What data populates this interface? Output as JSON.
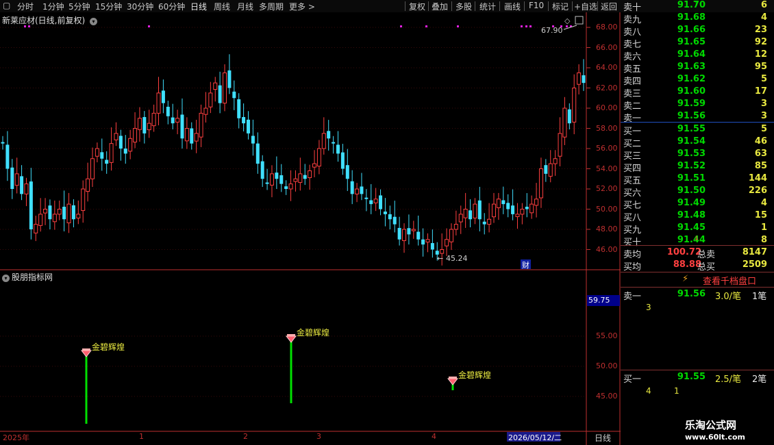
{
  "toolbar": {
    "periods": [
      "分时",
      "1分钟",
      "5分钟",
      "15分钟",
      "30分钟",
      "60分钟",
      "日线",
      "周线",
      "月线",
      "多周期",
      "更多"
    ],
    "actions": [
      "复权",
      "叠加",
      "多股",
      "统计",
      "画线",
      "F10",
      "标记",
      "+自选",
      "返回"
    ]
  },
  "chart": {
    "title": "新莱应材(日线,前复权)",
    "high_label": "67.90",
    "low_label": "45.24",
    "cai_badge": "财",
    "price_ticks": [
      "68.00",
      "66.00",
      "64.00",
      "62.00",
      "60.00",
      "58.00",
      "56.00",
      "54.00",
      "52.00",
      "50.00",
      "48.00",
      "46.00"
    ],
    "indicator_title": "股朋指标网",
    "indicator_ticks": [
      "55.00",
      "50.00",
      "45.00"
    ],
    "indicator_current": "59.75",
    "signal_label": "金碧辉煌",
    "date_axis": [
      "2025年",
      "1",
      "2",
      "3",
      "4"
    ],
    "cursor_date": "2026/05/12/二",
    "period_label": "日线"
  },
  "orderbook": {
    "asks": [
      {
        "label": "卖十",
        "price": "91.70",
        "vol": "6"
      },
      {
        "label": "卖九",
        "price": "91.68",
        "vol": "4"
      },
      {
        "label": "卖八",
        "price": "91.66",
        "vol": "23"
      },
      {
        "label": "卖七",
        "price": "91.65",
        "vol": "92"
      },
      {
        "label": "卖六",
        "price": "91.64",
        "vol": "12"
      },
      {
        "label": "卖五",
        "price": "91.63",
        "vol": "95"
      },
      {
        "label": "卖四",
        "price": "91.62",
        "vol": "5"
      },
      {
        "label": "卖三",
        "price": "91.60",
        "vol": "17"
      },
      {
        "label": "卖二",
        "price": "91.59",
        "vol": "3"
      },
      {
        "label": "卖一",
        "price": "91.56",
        "vol": "3"
      }
    ],
    "bids": [
      {
        "label": "买一",
        "price": "91.55",
        "vol": "5"
      },
      {
        "label": "买二",
        "price": "91.54",
        "vol": "46"
      },
      {
        "label": "买三",
        "price": "91.53",
        "vol": "63"
      },
      {
        "label": "买四",
        "price": "91.52",
        "vol": "85"
      },
      {
        "label": "买五",
        "price": "91.51",
        "vol": "144"
      },
      {
        "label": "买六",
        "price": "91.50",
        "vol": "226"
      },
      {
        "label": "买七",
        "price": "91.49",
        "vol": "4"
      },
      {
        "label": "买八",
        "price": "91.48",
        "vol": "15"
      },
      {
        "label": "买九",
        "price": "91.45",
        "vol": "1"
      },
      {
        "label": "买十",
        "price": "91.44",
        "vol": "8"
      }
    ],
    "avg_ask_label": "卖均",
    "avg_ask": "100.72",
    "total_ask_label": "总卖",
    "total_ask": "8147",
    "avg_bid_label": "买均",
    "avg_bid": "88.88",
    "total_bid_label": "总买",
    "total_bid": "2509",
    "depth_button": "查看千档盘口",
    "ask1_label": "卖一",
    "ask1_price": "91.56",
    "ask1_avg": "3.0/笔",
    "ask1_count": "1笔",
    "ask1_detail": "3",
    "bid1_label": "买一",
    "bid1_price": "91.55",
    "bid1_avg": "2.5/笔",
    "bid1_count": "2笔",
    "bid1_detail_1": "4",
    "bid1_detail_2": "1"
  },
  "watermark": {
    "name": "乐淘公式网",
    "url": "www.60lt.com"
  },
  "colors": {
    "up": "#ff4040",
    "down": "#40e0ff",
    "axis": "#c03030",
    "signal": "#00e000",
    "accent_yellow": "#e8e840"
  }
}
